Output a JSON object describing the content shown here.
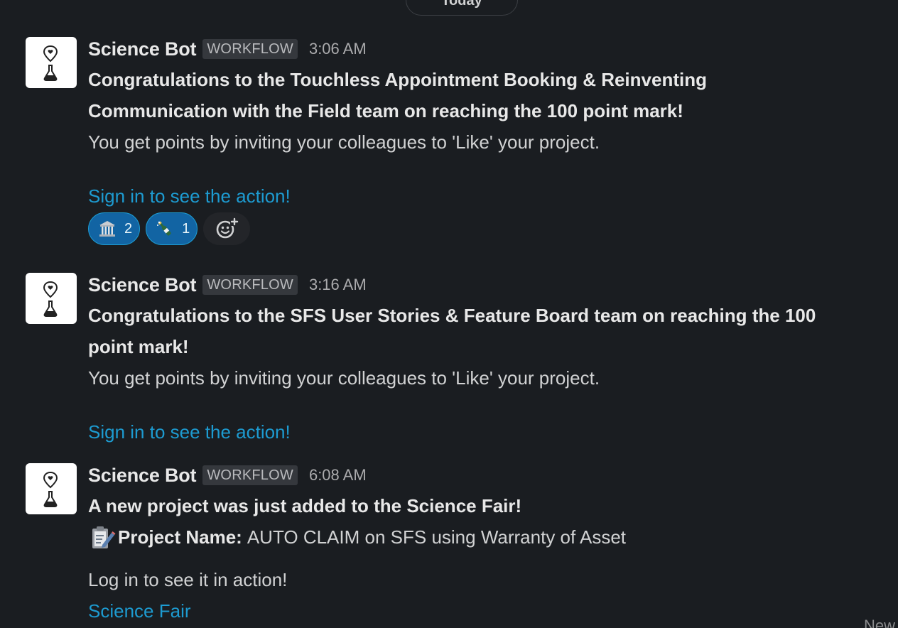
{
  "date_divider": "Today",
  "messages": [
    {
      "sender": "Science Bot",
      "badge": "WORKFLOW",
      "time": "3:06 AM",
      "headline_1": "Congratulations to the Touchless Appointment Booking & Reinventing",
      "headline_2": "Communication with the Field team on reaching the 100 point mark!",
      "body": "You get points by inviting your colleagues to 'Like' your project.",
      "link": "Sign in to see the action!",
      "reactions": [
        {
          "emoji": "classical-building-icon",
          "count": "2"
        },
        {
          "emoji": "champagne-bottle-icon",
          "count": "1"
        }
      ]
    },
    {
      "sender": "Science Bot",
      "badge": "WORKFLOW",
      "time": "3:16 AM",
      "headline_1": "Congratulations to the SFS User Stories & Feature Board team on reaching the 100",
      "headline_2": "point mark!",
      "body": "You get points by inviting your colleagues to 'Like' your project.",
      "link": "Sign in to see the action!"
    },
    {
      "sender": "Science Bot",
      "badge": "WORKFLOW",
      "time": "6:08 AM",
      "headline_1": "A new project was just added to the Science Fair!",
      "project_label": "Project Name:",
      "project_value": "AUTO CLAIM on SFS using Warranty of Asset",
      "body": "Log in to see it in action!",
      "link": "Science Fair"
    }
  ],
  "corner_text": "New",
  "colors": {
    "background": "#1a1d21",
    "link": "#1d9bd1",
    "reaction_bg": "#1264a3"
  }
}
